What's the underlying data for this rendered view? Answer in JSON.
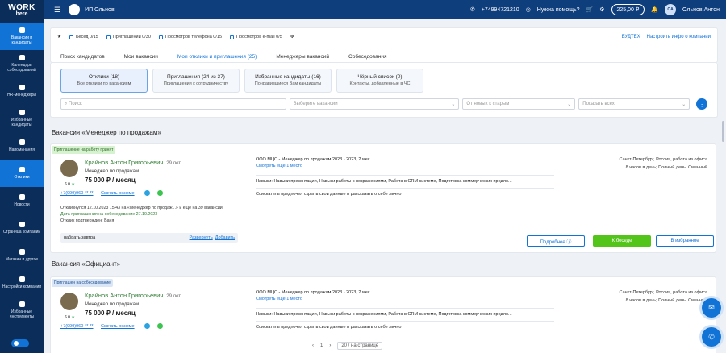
{
  "logo": {
    "line1": "WORK",
    "line2": "here"
  },
  "sidebar": {
    "items": [
      {
        "label": "Вакансии и кандидаты",
        "active": true
      },
      {
        "label": "Календарь собеседований"
      },
      {
        "label": "HR-менеджеры"
      },
      {
        "label": "Избранные кандидаты"
      },
      {
        "label": "Напоминания"
      },
      {
        "label": "Отклики",
        "active": true
      },
      {
        "label": "Новости"
      },
      {
        "label": "Страница компании"
      },
      {
        "label": "Магазин и другое"
      },
      {
        "label": "Настройки компании"
      },
      {
        "label": "Избранные инструменты"
      }
    ]
  },
  "topbar": {
    "company": "ИП Ольнов",
    "phone": "+74994721210",
    "help": "Нужна помощь?",
    "balance": "225,00 ₽",
    "user": "Ольнов Антон",
    "user_initials": "ОА"
  },
  "stats": {
    "items": [
      "Бесед 0/15",
      "Приглашений 0/30",
      "Просмотров телефона 0/15",
      "Просмотров e-mail 0/5"
    ],
    "link1": "ВУДТЕХ",
    "link2": "Настроить инфо о компании"
  },
  "tabs": [
    "Поиск кандидатов",
    "Мои вакансии",
    "Мои отклики и приглашения (25)",
    "Менеджеры вакансий",
    "Собеседования"
  ],
  "filter_tabs": [
    {
      "title": "Отклики (18)",
      "sub": "Все отклики по вакансиям"
    },
    {
      "title": "Приглашения (24 из 37)",
      "sub": "Приглашения к сотрудничеству"
    },
    {
      "title": "Избранные кандидаты (16)",
      "sub": "Понравившиеся Вам кандидаты"
    },
    {
      "title": "Чёрный список (0)",
      "sub": "Контакты, добавленные в ЧС"
    }
  ],
  "filters": {
    "search": "Поиск",
    "vacancy": "Выберите вакансии",
    "sort": "От новых к старым",
    "show": "Показать всех"
  },
  "vacancies": [
    {
      "title": "Вакансия «Менеджер по продажам»",
      "badge": "Приглашение на работу принят",
      "name": "Крайнов Антон Григорьевич",
      "age": "29 лет",
      "position": "Менеджер по продажам",
      "salary": "75 000 ₽ / месяц",
      "rating": "5.0",
      "phone": "+7(999)960-**-**",
      "resume": "Скачать резюме",
      "info1": "Откликнулся 12.10.2023 15:43  на «Менеджер по продаж...» и ещё на 39 вакансий",
      "info2": "Дата приглашения на собеседование 27.10.2023",
      "info3": "Отклик подтвержден: Ваня",
      "note": "набрать завтра",
      "note_expand": "Развернуть",
      "note_add": "Добавить",
      "exp_company": "ООО МЦС - Менеджер по продажам  2023 - 2023, 2 мес.",
      "exp_more": "Смотреть ещё 1 место",
      "skills": "Навыки: Навыки презентации, Навыки работы с возражениями, Работа в CRM системе, Подготовка коммерческих предло...",
      "hidden": "Соискатель предпочел скрыть свои данные и рассказать о себе лично",
      "loc1": "Санкт-Петербург, Россия, работа из офиса",
      "loc2": "8 часов в день; Полный день, Сменный",
      "btn_more": "Подробнее ⓘ",
      "btn_chat": "К беседе",
      "btn_fav": "В избранное"
    },
    {
      "title": "Вакансия «Официант»",
      "badge": "Приглашен на собеседование",
      "name": "Крайнов Антон Григорьевич",
      "age": "29 лет",
      "position": "Менеджер по продажам",
      "salary": "75 000 ₽ / месяц",
      "rating": "5.0",
      "phone": "+7(999)960-**-**",
      "resume": "Скачать резюме",
      "exp_company": "ООО МЦС - Менеджер по продажам  2023 - 2023, 2 мес.",
      "exp_more": "Смотреть ещё 1 место",
      "skills": "Навыки: Навыки презентации, Навыки работы с возражениями, Работа в CRM системе, Подготовка коммерческих предло...",
      "hidden": "Соискатель предпочел скрыть свои данные и рассказать о себе лично",
      "loc1": "Санкт-Петербург, Россия, работа из офиса",
      "loc2": "8 часов в день; Полный день, Сменный"
    }
  ],
  "pager": {
    "prev": "‹",
    "page": "1",
    "next": "›",
    "per_page": "20 / на странице"
  }
}
